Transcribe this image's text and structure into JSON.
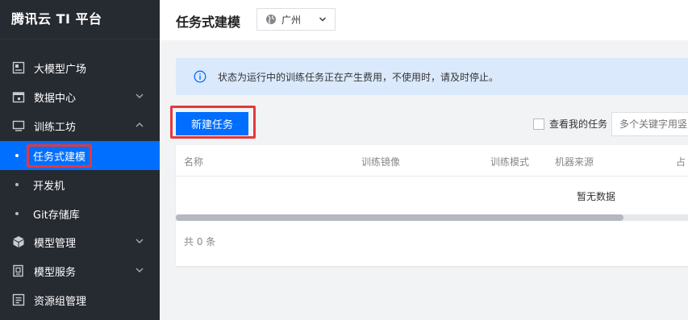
{
  "app": {
    "title": "腾讯云 TI 平台"
  },
  "sidebar": {
    "items": [
      {
        "label": "大模型广场",
        "icon": "model-plaza-icon"
      },
      {
        "label": "数据中心",
        "icon": "calendar-icon",
        "expandable": true
      },
      {
        "label": "训练工坊",
        "icon": "monitor-icon",
        "expanded": true
      },
      {
        "label": "模型管理",
        "icon": "cube-icon",
        "expandable": true
      },
      {
        "label": "模型服务",
        "icon": "document-icon",
        "expandable": true
      },
      {
        "label": "资源组管理",
        "icon": "list-icon"
      }
    ],
    "sub_items": [
      {
        "label": "任务式建模",
        "active": true
      },
      {
        "label": "开发机"
      },
      {
        "label": "Git存储库"
      }
    ]
  },
  "header": {
    "title": "任务式建模",
    "region": "广州"
  },
  "notice": {
    "text": "状态为运行中的训练任务正在产生费用，不使用时，请及时停止。"
  },
  "toolbar": {
    "new_task_label": "新建任务",
    "my_tasks_label": "查看我的任务",
    "search_placeholder": "多个关键字用竖"
  },
  "table": {
    "columns": [
      "名称",
      "训练镜像",
      "训练模式",
      "机器来源",
      "占"
    ],
    "empty_text": "暂无数据",
    "total_text": "共 0 条"
  },
  "colors": {
    "sidebar_bg": "#262a31",
    "accent": "#006eff",
    "highlight": "#e3393b",
    "notice_bg": "#dbe9fd"
  }
}
